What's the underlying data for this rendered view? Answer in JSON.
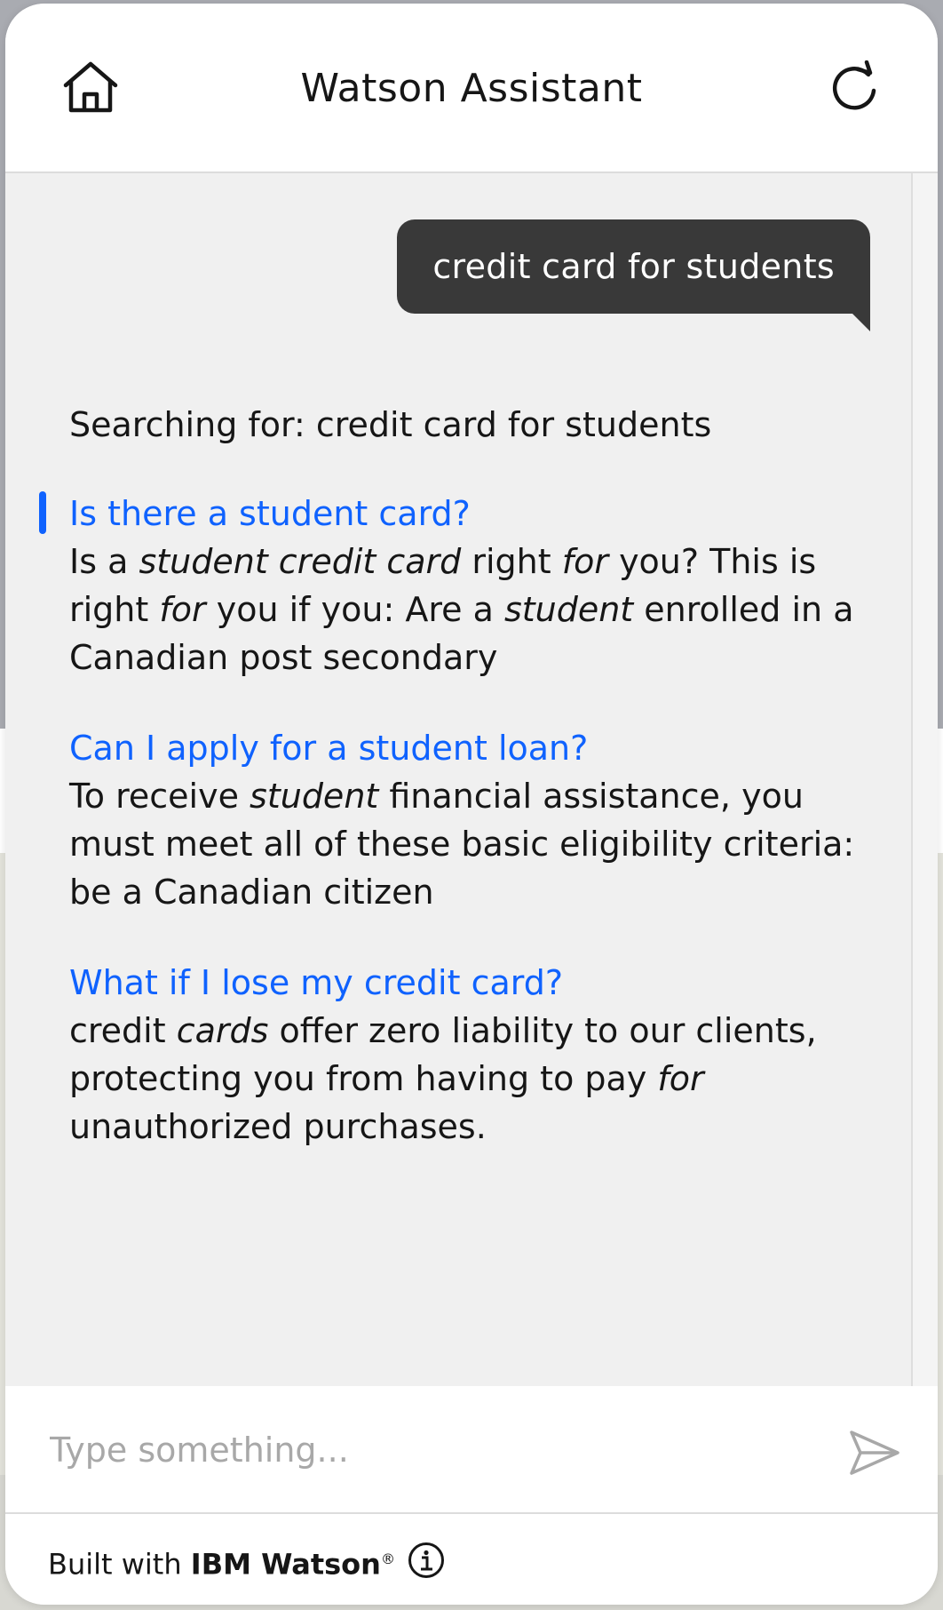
{
  "header": {
    "title": "Watson Assistant",
    "home_icon": "home-icon",
    "refresh_icon": "refresh-icon"
  },
  "conversation": {
    "user_message": "credit card for students",
    "bot_intro": "Searching for: credit card for students",
    "results": [
      {
        "title": "Is there a student card?",
        "body_segments": [
          {
            "text": "Is a ",
            "italic": false
          },
          {
            "text": "student credit card",
            "italic": true
          },
          {
            "text": " right ",
            "italic": false
          },
          {
            "text": "for",
            "italic": true
          },
          {
            "text": " you? This is right ",
            "italic": false
          },
          {
            "text": "for",
            "italic": true
          },
          {
            "text": " you if you: Are a ",
            "italic": false
          },
          {
            "text": "student",
            "italic": true
          },
          {
            "text": " enrolled in a Canadian post secondary",
            "italic": false
          }
        ]
      },
      {
        "title": "Can I apply for a student loan?",
        "body_segments": [
          {
            "text": "To receive ",
            "italic": false
          },
          {
            "text": "student",
            "italic": true
          },
          {
            "text": " financial assistance, you must meet all of these basic eligibility criteria: be a Canadian citizen",
            "italic": false
          }
        ]
      },
      {
        "title": "What if I lose my credit card?",
        "body_segments": [
          {
            "text": "credit ",
            "italic": false
          },
          {
            "text": "cards",
            "italic": true
          },
          {
            "text": " offer zero liability to our clients, protecting you from having to pay ",
            "italic": false
          },
          {
            "text": "for",
            "italic": true
          },
          {
            "text": " unauthorized purchases.",
            "italic": false
          }
        ]
      }
    ]
  },
  "help_button": {
    "label": "?"
  },
  "input": {
    "placeholder": "Type something...",
    "value": "",
    "send_icon": "send-icon"
  },
  "footer": {
    "prefix": "Built with ",
    "brand": "IBM Watson",
    "trademark": "®",
    "info_icon": "info-icon"
  },
  "colors": {
    "accent": "#0f62fe",
    "user_bubble": "#393939",
    "panel_background": "#f0f0f0"
  }
}
